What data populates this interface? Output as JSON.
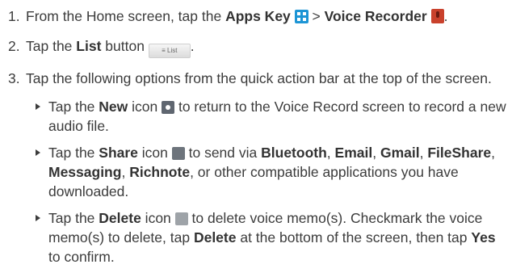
{
  "steps": [
    {
      "num": "1.",
      "t1": "From the Home screen, tap the ",
      "b1": "Apps Key",
      "t2": " > ",
      "b2": "Voice Recorder",
      "t3": "."
    },
    {
      "num": "2.",
      "t1": "Tap the ",
      "b1": "List",
      "t2": " button ",
      "icon_label": "≡ List",
      "t3": "."
    },
    {
      "num": "3.",
      "text": "Tap the following options from the quick action bar at the top of the screen."
    }
  ],
  "bullets": [
    {
      "t1": "Tap the ",
      "b1": "New",
      "t2": " icon ",
      "t3": " to return to the Voice Record screen to record a new audio file."
    },
    {
      "t1": "Tap the ",
      "b1": "Share",
      "t2": " icon ",
      "t3": " to send via ",
      "b2": "Bluetooth",
      "t4": ", ",
      "b3": "Email",
      "t5": ", ",
      "b4": "Gmail",
      "t6": ", ",
      "b5": "FileShare",
      "t7": ", ",
      "b6": "Messaging",
      "t8": ", ",
      "b7": "Richnote",
      "t9": ", or other compatible applications you have downloaded."
    },
    {
      "t1": "Tap the ",
      "b1": "Delete",
      "t2": " icon ",
      "t3": " to delete voice memo(s). Checkmark the voice memo(s) to delete, tap ",
      "b2": "Delete",
      "t4": " at the bottom of the screen, then tap ",
      "b3": "Yes",
      "t5": " to confirm."
    }
  ],
  "icons": {
    "apps": "apps-key-icon",
    "recorder": "voice-recorder-icon",
    "list": "list-button-icon",
    "new": "new-icon",
    "share": "share-icon",
    "delete": "delete-icon"
  }
}
